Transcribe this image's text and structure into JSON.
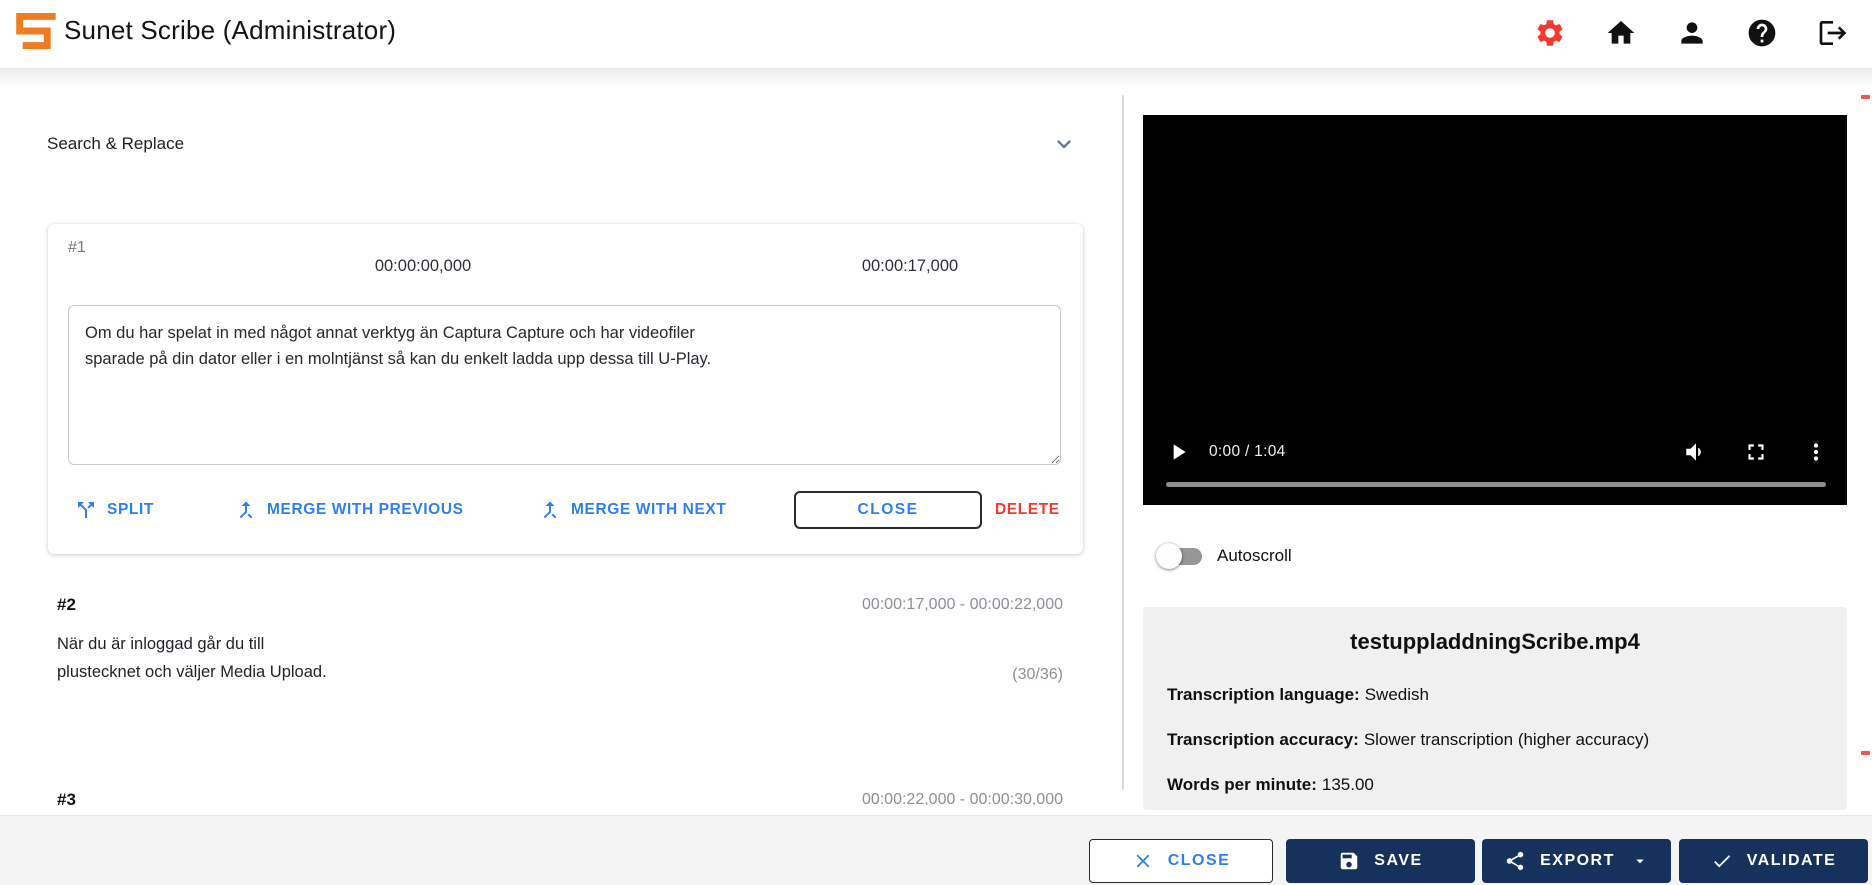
{
  "app": {
    "title": "Sunet Scribe (Administrator)"
  },
  "header": {
    "icons": [
      {
        "name": "settings-gear",
        "color": "#f43b30"
      },
      {
        "name": "home",
        "color": "#111111"
      },
      {
        "name": "profile-person",
        "color": "#111111"
      },
      {
        "name": "help-question",
        "color": "#111111"
      },
      {
        "name": "logout",
        "color": "#111111"
      }
    ]
  },
  "left_panel": {
    "search_and_replace": {
      "label": "Search & Replace"
    },
    "editor": {
      "number": "#1",
      "start_time": "00:00:00,000",
      "end_time": "00:00:17,000",
      "text": "Om du har spelat in med något annat verktyg än Captura Capture och har videofiler\nsparade på din dator eller i en molntjänst så kan du enkelt ladda upp dessa till U-Play.",
      "actions": {
        "split": "SPLIT",
        "merge_previous": "MERGE WITH PREVIOUS",
        "merge_next": "MERGE WITH NEXT",
        "close": "CLOSE",
        "delete": "DELETE"
      }
    },
    "segments": [
      {
        "number": "#2",
        "time_range": "00:00:17,000 - 00:00:22,000",
        "lines": [
          "När du är inloggad går du till",
          "plustecknet och väljer Media Upload."
        ],
        "char_count": "(30/36)"
      },
      {
        "number": "#3",
        "time_range": "00:00:22,000 - 00:00:30,000"
      }
    ]
  },
  "video_player": {
    "time_display": "0:00 / 1:04"
  },
  "autoscroll": {
    "label": "Autoscroll",
    "enabled": false
  },
  "media_info": {
    "filename": "testuppladdningScribe.mp4",
    "details": [
      {
        "label": "Transcription language:",
        "value": "Swedish"
      },
      {
        "label": "Transcription accuracy:",
        "value": "Slower transcription (higher accuracy)"
      },
      {
        "label": "Words per minute:",
        "value": "135.00"
      }
    ]
  },
  "footer": {
    "close": "CLOSE",
    "save": "SAVE",
    "export": "EXPORT",
    "validate": "VALIDATE"
  },
  "colors": {
    "accent_blue": "#2f80ed",
    "navy": "#16325c",
    "red": "#f43b30",
    "logo_orange": "#ee7d22"
  }
}
